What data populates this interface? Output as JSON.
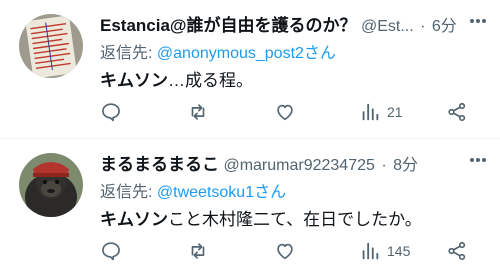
{
  "tweets": [
    {
      "display_name": "Estancia@誰が自由を護るのか？",
      "handle": "@Est...",
      "dot": "·",
      "time": "6分",
      "reply_prefix": "返信先: ",
      "reply_to": "@anonymous_post2さん",
      "body_bold": "キムソン",
      "body_rest": "…成る程。",
      "views": "21",
      "avatar_icon": "paper-document-avatar"
    },
    {
      "display_name": "まるまるまるこ",
      "handle": "@marumar92234725",
      "dot": "·",
      "time": "8分",
      "reply_prefix": "返信先: ",
      "reply_to": "@tweetsoku1さん",
      "body_bold": "キムソン",
      "body_rest": "こと木村隆二て、在日でしたか。",
      "views": "145",
      "avatar_icon": "gorilla-avatar"
    }
  ],
  "colors": {
    "text": "#0f1419",
    "secondary": "#536471",
    "link": "#1d9bf0",
    "divider": "#eff3f4"
  }
}
